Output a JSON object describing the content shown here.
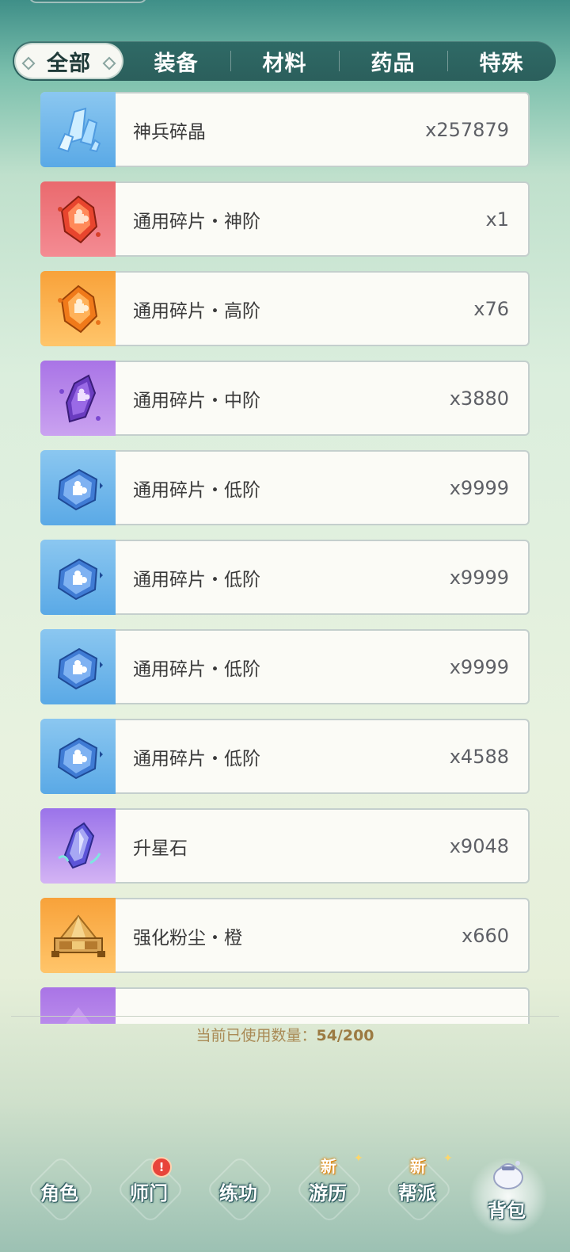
{
  "tabs": [
    {
      "label": "全部",
      "active": true
    },
    {
      "label": "装备",
      "active": false
    },
    {
      "label": "材料",
      "active": false
    },
    {
      "label": "药品",
      "active": false
    },
    {
      "label": "特殊",
      "active": false
    }
  ],
  "items": [
    {
      "name": "神兵碎晶",
      "count": "x257879",
      "icon": "blue-crystal-icon",
      "rarity": "blue"
    },
    {
      "name": "通用碎片・神阶",
      "count": "x1",
      "icon": "red-puzzle-shard-icon",
      "rarity": "red"
    },
    {
      "name": "通用碎片・高阶",
      "count": "x76",
      "icon": "orange-puzzle-shard-icon",
      "rarity": "orange"
    },
    {
      "name": "通用碎片・中阶",
      "count": "x3880",
      "icon": "purple-puzzle-shard-icon",
      "rarity": "purple"
    },
    {
      "name": "通用碎片・低阶",
      "count": "x9999",
      "icon": "blue-puzzle-cube-icon",
      "rarity": "blue"
    },
    {
      "name": "通用碎片・低阶",
      "count": "x9999",
      "icon": "blue-puzzle-cube-icon",
      "rarity": "blue"
    },
    {
      "name": "通用碎片・低阶",
      "count": "x9999",
      "icon": "blue-puzzle-cube-icon",
      "rarity": "blue"
    },
    {
      "name": "通用碎片・低阶",
      "count": "x4588",
      "icon": "blue-puzzle-cube-icon",
      "rarity": "blue"
    },
    {
      "name": "升星石",
      "count": "x9048",
      "icon": "star-stone-icon",
      "rarity": "violet"
    },
    {
      "name": "强化粉尘・橙",
      "count": "x660",
      "icon": "dust-pile-icon",
      "rarity": "orange"
    }
  ],
  "usage": {
    "label": "当前已使用数量：",
    "value": "54/200"
  },
  "nav": [
    {
      "label": "角色",
      "badge": ""
    },
    {
      "label": "师门",
      "badge": "!"
    },
    {
      "label": "练功",
      "badge": ""
    },
    {
      "label": "游历",
      "badge": "新"
    },
    {
      "label": "帮派",
      "badge": "新"
    },
    {
      "label": "背包",
      "badge": "",
      "active": true
    }
  ],
  "colors": {
    "tabbar": "#2b5f5c",
    "blue": "#5aa9e6",
    "red": "#ea6a6e",
    "orange": "#f8a23a",
    "purple": "#a974e6",
    "badge_red": "#e8443a",
    "badge_new": "#e08a16"
  }
}
